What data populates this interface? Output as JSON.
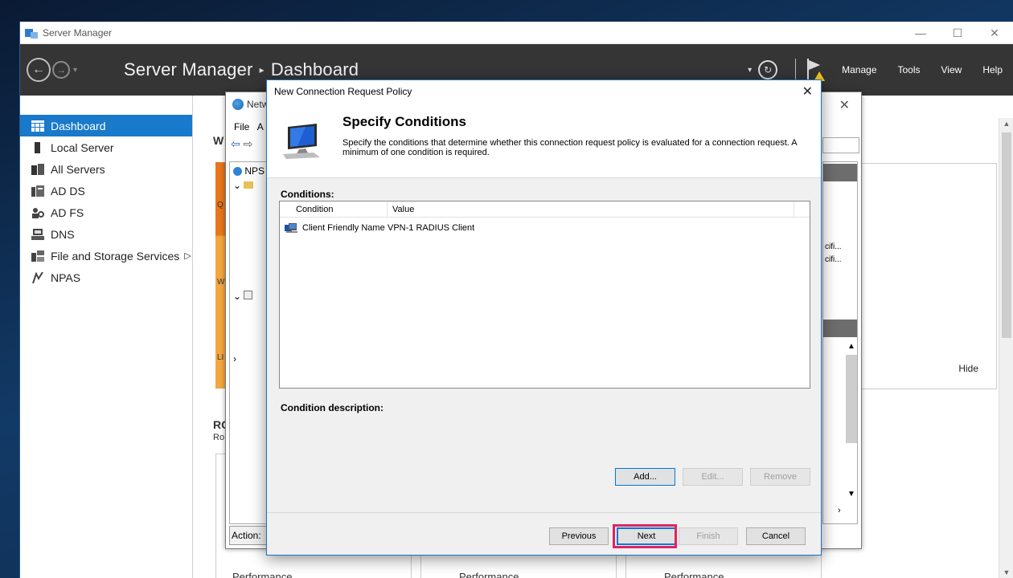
{
  "window": {
    "title": "Server Manager",
    "controls": {
      "minimize": "—",
      "maximize": "☐",
      "close": "✕"
    }
  },
  "header": {
    "breadcrumb_root": "Server Manager",
    "breadcrumb_sep": "▸",
    "breadcrumb_current": "Dashboard",
    "menu": [
      "Manage",
      "Tools",
      "View",
      "Help"
    ]
  },
  "sidebar": {
    "items": [
      {
        "label": "Dashboard",
        "icon": "dashboard-icon",
        "active": true
      },
      {
        "label": "Local Server",
        "icon": "server-icon"
      },
      {
        "label": "All Servers",
        "icon": "servers-icon"
      },
      {
        "label": "AD DS",
        "icon": "adds-icon"
      },
      {
        "label": "AD FS",
        "icon": "adfs-icon"
      },
      {
        "label": "DNS",
        "icon": "dns-icon"
      },
      {
        "label": "File and Storage Services",
        "icon": "storage-icon",
        "arrow": "▷"
      },
      {
        "label": "NPAS",
        "icon": "npas-icon"
      }
    ]
  },
  "dashboard": {
    "welcome_fragment": "W",
    "ro_fragment": "RC",
    "ro_sub_fragment": "Ro",
    "col_letters": [
      "Q",
      "W",
      "LI"
    ],
    "hide_label": "Hide",
    "perf_labels": [
      "Performance",
      "Performance",
      "Performance"
    ]
  },
  "nps": {
    "title_fragment": "Netw",
    "menu_file": "File",
    "menu_a": "A",
    "tree_root": "NPS",
    "action_label": "Action:",
    "right_fragments": [
      "cifi...",
      "cifi..."
    ]
  },
  "dialog": {
    "title": "New Connection Request Policy",
    "heading": "Specify Conditions",
    "description": "Specify the conditions that determine whether this connection request policy is evaluated for a connection request. A minimum of one condition is required.",
    "conditions_label": "Conditions:",
    "columns": [
      "Condition",
      "Value"
    ],
    "rows": [
      {
        "condition": "Client Friendly Name",
        "value": "VPN-1 RADIUS Client"
      }
    ],
    "condition_description_label": "Condition description:",
    "buttons": {
      "add": "Add...",
      "edit": "Edit...",
      "remove": "Remove",
      "previous": "Previous",
      "next": "Next",
      "finish": "Finish",
      "cancel": "Cancel"
    }
  },
  "colors": {
    "accent": "#1979ca",
    "header_bg": "#353535",
    "highlight": "#e0245e",
    "orange": "#e8761c"
  }
}
